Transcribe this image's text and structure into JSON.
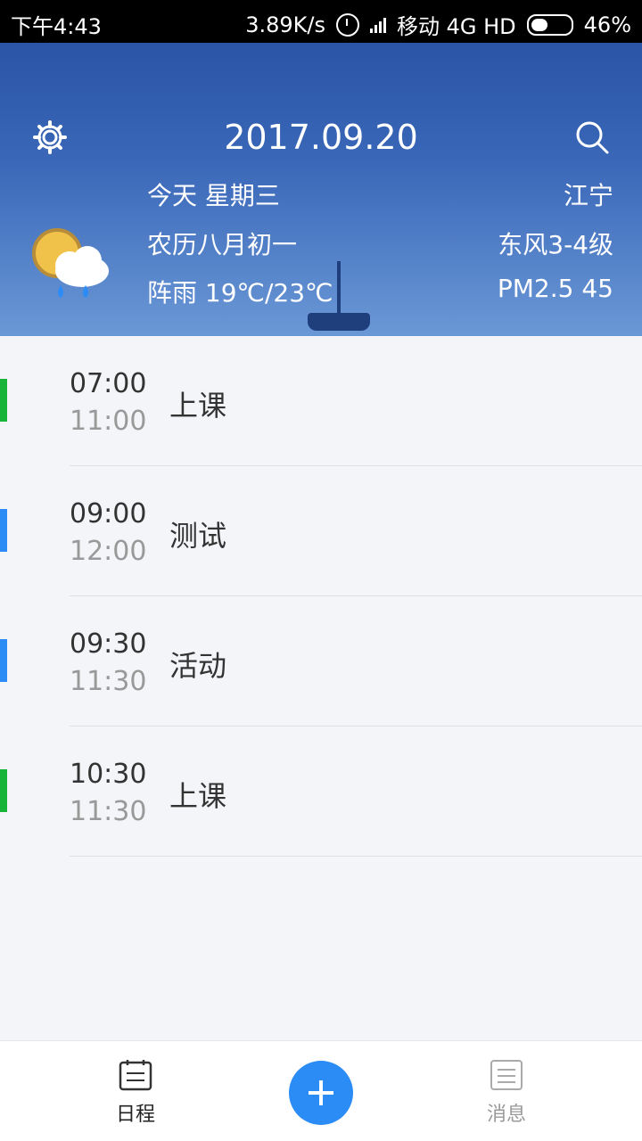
{
  "status_bar": {
    "time": "下午4:43",
    "speed": "3.89K/s",
    "carrier": "移动 4G HD",
    "battery_text": "46%",
    "battery_level": 0.46
  },
  "header": {
    "title": "2017.09.20",
    "day": "今天 星期三",
    "lunar": "农历八月初一",
    "weather": "阵雨 19℃/23℃",
    "location": "江宁",
    "wind": "东风3-4级",
    "pm": "PM2.5 45",
    "icons": [
      "gear-icon",
      "search-icon",
      "weather-icon"
    ]
  },
  "events": [
    {
      "start": "07:00",
      "end": "11:00",
      "title": "上课",
      "color": "#18b43a"
    },
    {
      "start": "09:00",
      "end": "12:00",
      "title": "测试",
      "color": "#2b8cf5"
    },
    {
      "start": "09:30",
      "end": "11:30",
      "title": "活动",
      "color": "#2b8cf5"
    },
    {
      "start": "10:30",
      "end": "11:30",
      "title": "上课",
      "color": "#18b43a"
    }
  ],
  "tabs": [
    {
      "label": "日程",
      "icon": "calendar-icon",
      "active": true
    },
    {
      "label": "消息",
      "icon": "message-icon",
      "active": false
    }
  ],
  "fab_icon": "plus-icon",
  "colors": {
    "header_top": "#2b55a6",
    "accent": "#2b8cf5",
    "green": "#18b43a"
  }
}
